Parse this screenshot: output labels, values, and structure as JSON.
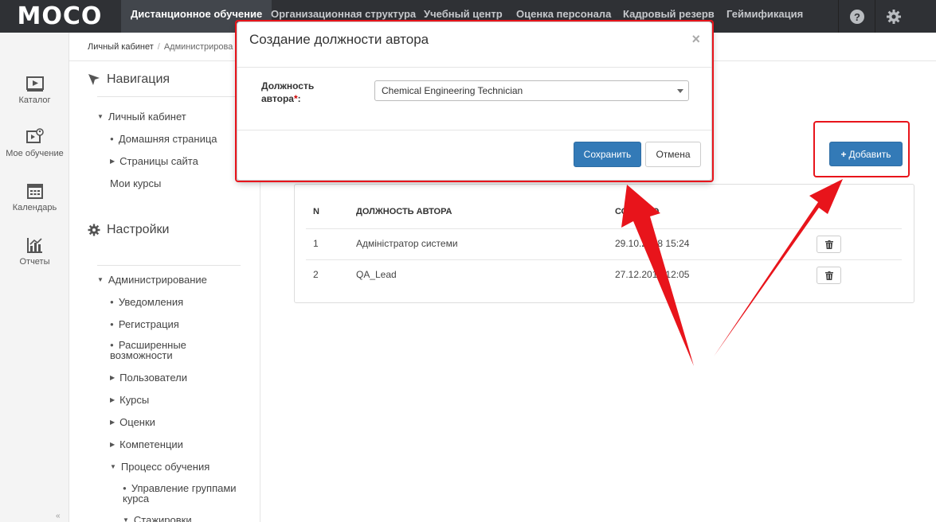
{
  "app": {
    "logo_text": "MOCO"
  },
  "topnav": {
    "items": [
      {
        "label": "Дистанционное обучение"
      },
      {
        "label": "Организационная структура"
      },
      {
        "label": "Учебный центр"
      },
      {
        "label": "Оценка персонала"
      },
      {
        "label": "Кадровый резерв"
      },
      {
        "label": "Геймификация"
      }
    ],
    "icons": [
      "help-icon",
      "gear-icon"
    ]
  },
  "rail": {
    "items": [
      {
        "label": "Каталог",
        "icon": "catalog-icon"
      },
      {
        "label": "Мое обучение",
        "icon": "my-learning-icon"
      },
      {
        "label": "Календарь",
        "icon": "calendar-icon"
      },
      {
        "label": "Отчеты",
        "icon": "reports-icon"
      }
    ],
    "collapse": "«"
  },
  "breadcrumb": {
    "home": "Личный кабинет",
    "sep": "/",
    "current": "Администрирова"
  },
  "sidenav": {
    "navigation_title": "Навигация",
    "settings_title": "Настройки",
    "items": [
      {
        "label": "Личный кабинет",
        "marker": "▼"
      },
      {
        "label": "Домашняя страница",
        "marker": "●"
      },
      {
        "label": "Страницы сайта",
        "marker": "▶"
      },
      {
        "label": "Мои курсы",
        "marker": ""
      },
      {
        "label": "Администрирование",
        "marker": "▼"
      },
      {
        "label": "Уведомления",
        "marker": "●"
      },
      {
        "label": "Регистрация",
        "marker": "●"
      },
      {
        "label": "Расширенные",
        "marker": "●"
      },
      {
        "label": "возможности",
        "marker": ""
      },
      {
        "label": "Пользователи",
        "marker": "▶"
      },
      {
        "label": "Курсы",
        "marker": "▶"
      },
      {
        "label": "Оценки",
        "marker": "▶"
      },
      {
        "label": "Компетенции",
        "marker": "▶"
      },
      {
        "label": "Процесс обучения",
        "marker": "▼"
      },
      {
        "label": "Управление группами",
        "marker": "●"
      },
      {
        "label": "курса",
        "marker": ""
      },
      {
        "label": "Стажировки",
        "marker": "▼"
      }
    ]
  },
  "table": {
    "headers": {
      "n": "N",
      "position": "ДОЛЖНОСТЬ АВТОРА",
      "created": "СОЗДАНО"
    },
    "rows": [
      {
        "n": "1",
        "position": "Адміністратор системи",
        "created": "29.10.2018 15:24"
      },
      {
        "n": "2",
        "position": "QA_Lead",
        "created": "27.12.2018 12:05"
      }
    ]
  },
  "add_button": {
    "icon": "+",
    "label": "Добавить"
  },
  "modal": {
    "title": "Создание должности автора",
    "close": "×",
    "field_label_1": "Должность",
    "field_label_2": "автора",
    "required_mark": "*",
    "field_colon": ":",
    "selected_value": "Chemical Engineering Technician",
    "save_label": "Сохранить",
    "cancel_label": "Отмена"
  },
  "colors": {
    "topbar": "#2f3135",
    "primary": "#337ab7",
    "annotation": "#e8141b"
  }
}
